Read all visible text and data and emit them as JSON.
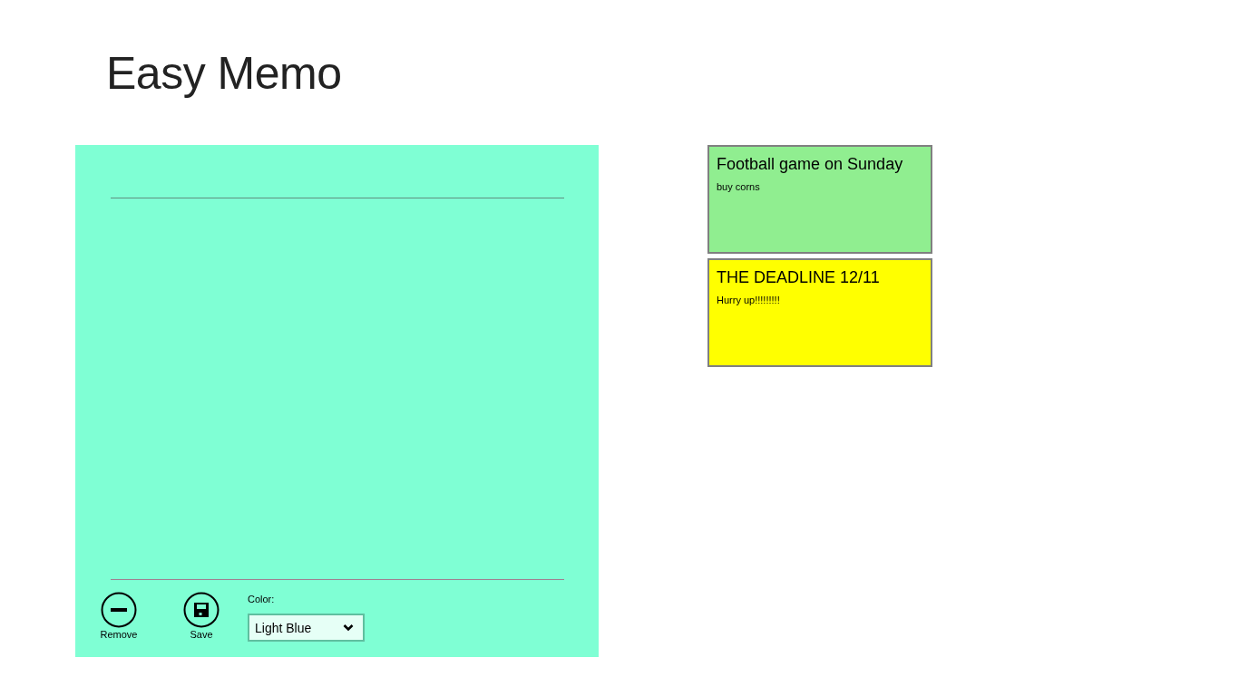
{
  "app": {
    "title": "Easy Memo"
  },
  "editor": {
    "actions": [
      {
        "kind": "remove",
        "label": "Remove"
      },
      {
        "kind": "save",
        "label": "Save"
      }
    ],
    "color_picker": {
      "label": "Color:",
      "value": "Light Blue"
    }
  },
  "memos": [
    {
      "title": "Football game on Sunday",
      "body": "buy corns",
      "color": "#90ee90"
    },
    {
      "title": "THE DEADLINE 12/11",
      "body": "Hurry up!!!!!!!!!",
      "color": "#ffff00"
    }
  ]
}
